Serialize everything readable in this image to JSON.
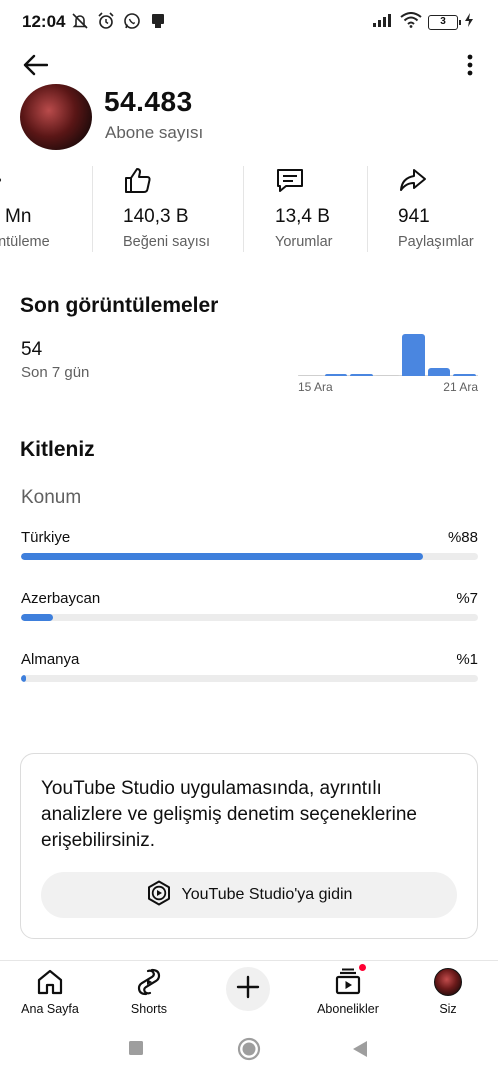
{
  "status_bar": {
    "time": "12:04",
    "battery": "3",
    "icons": [
      "mute-icon",
      "alarm-icon",
      "whatsapp-icon",
      "notification-icon",
      "signal-icon",
      "wifi-icon",
      "battery-icon",
      "charging-icon"
    ]
  },
  "header": {
    "back_icon": "arrow-left-icon",
    "more_icon": "more-vertical-icon"
  },
  "channel": {
    "subscriber_count": "54.483",
    "subscriber_label": "Abone sayısı"
  },
  "stats": [
    {
      "value": "Mn",
      "label": "üntüleme",
      "icon": "eye-icon"
    },
    {
      "value": "140,3 B",
      "label": "Beğeni sayısı",
      "icon": "thumbs-up-icon"
    },
    {
      "value": "13,4 B",
      "label": "Yorumlar",
      "icon": "comment-icon"
    },
    {
      "value": "941",
      "label": "Paylaşımlar",
      "icon": "share-icon"
    }
  ],
  "recent_views": {
    "title": "Son görüntülemeler",
    "value": "54",
    "period": "Son 7 gün",
    "chart_data": {
      "type": "bar",
      "values": [
        0,
        1,
        1,
        0,
        54,
        10,
        1
      ],
      "x_start_label": "15 Ara",
      "x_end_label": "21 Ara"
    }
  },
  "audience": {
    "title": "Kitleniz",
    "location_title": "Konum",
    "locations": [
      {
        "name": "Türkiye",
        "percent_label": "%88",
        "share": 0.88
      },
      {
        "name": "Azerbaycan",
        "percent_label": "%7",
        "share": 0.07
      },
      {
        "name": "Almanya",
        "percent_label": "%1",
        "share": 0.01
      }
    ]
  },
  "studio_card": {
    "text": "YouTube Studio uygulamasında, ayrıntılı analizlere ve gelişmiş denetim seçeneklerine erişebilirsiniz.",
    "button_label": "YouTube Studio'ya gidin"
  },
  "bottom_nav": [
    {
      "label": "Ana Sayfa",
      "icon": "home-icon"
    },
    {
      "label": "Shorts",
      "icon": "shorts-icon"
    },
    {
      "label": "",
      "icon": "create-plus-icon"
    },
    {
      "label": "Abonelikler",
      "icon": "subscriptions-icon"
    },
    {
      "label": "Siz",
      "icon": "avatar"
    }
  ],
  "colors": {
    "accent_blue": "#3e7fdc",
    "text_primary": "#0f0f0f",
    "text_secondary": "#606060",
    "notification_red": "#ff0033"
  }
}
